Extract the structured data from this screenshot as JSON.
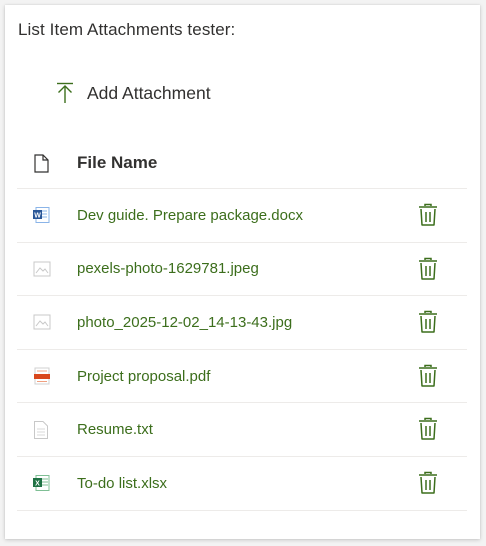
{
  "title": "List Item Attachments tester:",
  "add_attachment_label": "Add Attachment",
  "table": {
    "column_file_name": "File Name"
  },
  "files": [
    {
      "name": "Dev guide. Prepare package.docx",
      "icon": "word-file-icon"
    },
    {
      "name": "pexels-photo-1629781.jpeg",
      "icon": "image-file-icon"
    },
    {
      "name": "photo_2025-12-02_14-13-43.jpg",
      "icon": "image-file-icon"
    },
    {
      "name": "Project proposal.pdf",
      "icon": "pdf-file-icon"
    },
    {
      "name": "Resume.txt",
      "icon": "text-file-icon"
    },
    {
      "name": "To-do list.xlsx",
      "icon": "excel-file-icon"
    }
  ],
  "colors": {
    "accent": "#3c6e1c",
    "text": "#323130",
    "divider": "#edebe9"
  }
}
